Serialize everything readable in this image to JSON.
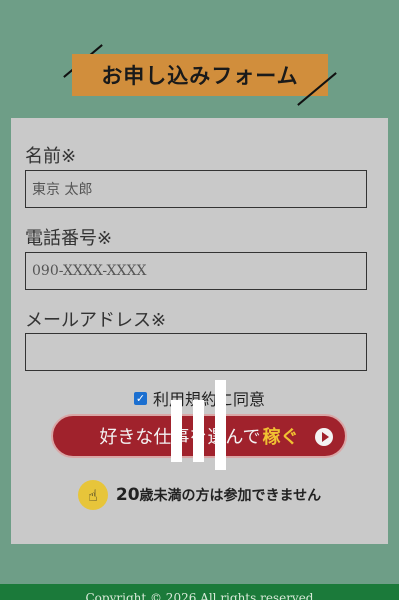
{
  "banner": {
    "title": "お申し込みフォーム"
  },
  "form": {
    "name": {
      "label": "名前※",
      "placeholder": "東京 太郎"
    },
    "phone": {
      "label": "電話番号※",
      "placeholder": "090-XXXX-XXXX"
    },
    "email": {
      "label": "メールアドレス※",
      "placeholder": ""
    },
    "agree": {
      "checked": true,
      "label": "利用規約に同意"
    },
    "submit": {
      "label_main": "好きな仕事を選んで",
      "label_highlight": "稼ぐ",
      "icon": "play-circle-icon"
    },
    "note": {
      "icon": "finger-point-icon",
      "age": "20",
      "text": "歳未満の方は参加できません"
    }
  },
  "footer": {
    "copyright": "Copyright © 2026 All rights reserved"
  },
  "colors": {
    "background": "#6e9e87",
    "banner": "#d18e3c",
    "card": "#c9c9c9",
    "button": "#a0222c",
    "button_highlight": "#f1c232",
    "checkbox": "#1b6fd0",
    "footer": "#1b7a3a"
  }
}
